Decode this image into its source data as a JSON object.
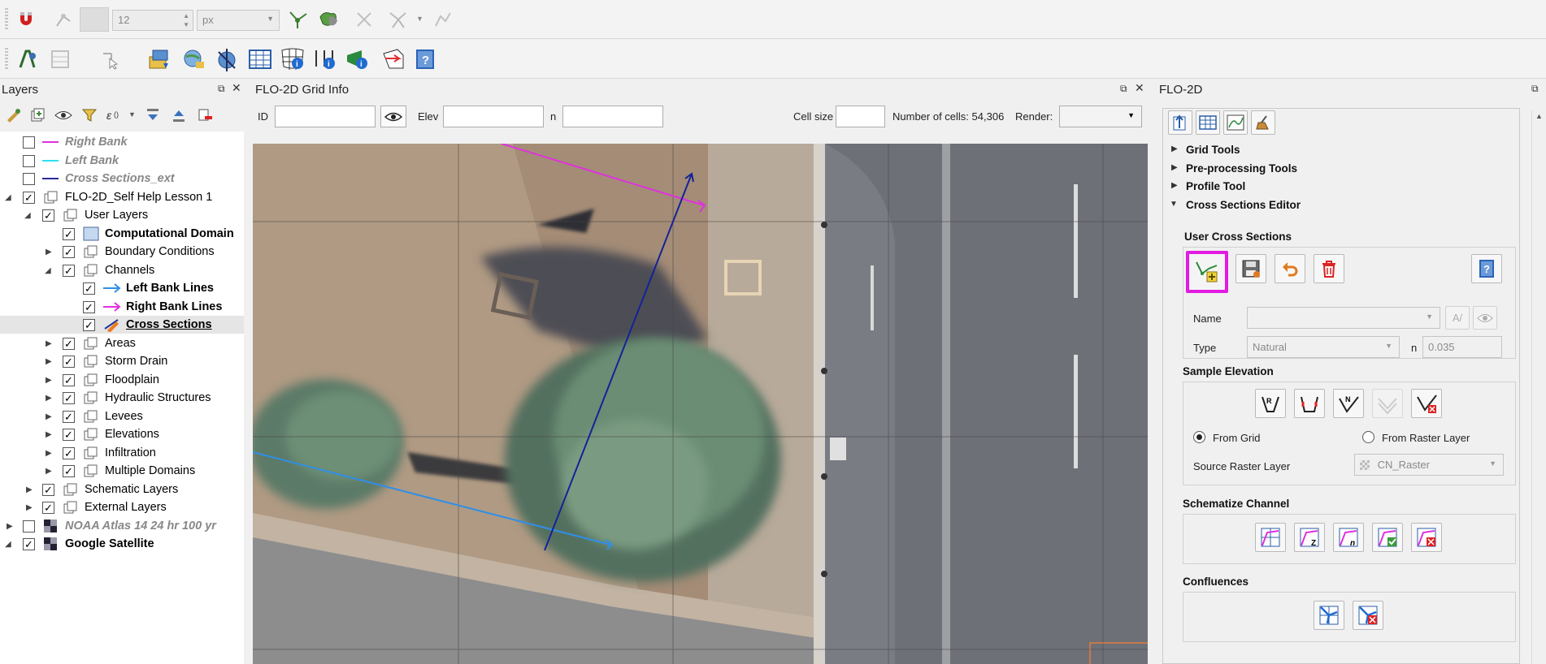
{
  "toolbar1": {
    "snap_size_value": "12",
    "snap_unit": "px"
  },
  "layers_panel": {
    "title": "Layers",
    "items": [
      {
        "label": "Right Bank",
        "checked": false,
        "style": "italic-gray",
        "legend": "magenta-line"
      },
      {
        "label": "Left Bank",
        "checked": false,
        "style": "italic-gray",
        "legend": "cyan-line"
      },
      {
        "label": "Cross Sections_ext",
        "checked": false,
        "style": "italic-gray",
        "legend": "navy-line"
      },
      {
        "label": "FLO-2D_Self Help Lesson 1",
        "checked": true,
        "style": "normal",
        "legend": "group-icon"
      },
      {
        "label": "User Layers",
        "checked": true,
        "style": "normal",
        "legend": "group-icon"
      },
      {
        "label": "Computational Domain",
        "checked": true,
        "style": "bold",
        "legend": "polygon-fill"
      },
      {
        "label": "Boundary Conditions",
        "checked": true,
        "style": "normal",
        "legend": "group-icon"
      },
      {
        "label": "Channels",
        "checked": true,
        "style": "normal",
        "legend": "group-icon"
      },
      {
        "label": "Left Bank Lines",
        "checked": true,
        "style": "bold",
        "legend": "blue-arrow"
      },
      {
        "label": "Right Bank Lines",
        "checked": true,
        "style": "bold",
        "legend": "magenta-arrow"
      },
      {
        "label": "Cross Sections",
        "checked": true,
        "style": "bold-underline",
        "legend": "edit-pencil"
      },
      {
        "label": "Areas",
        "checked": true,
        "style": "normal",
        "legend": "group-icon"
      },
      {
        "label": "Storm Drain",
        "checked": true,
        "style": "normal",
        "legend": "group-icon"
      },
      {
        "label": "Floodplain",
        "checked": true,
        "style": "normal",
        "legend": "group-icon"
      },
      {
        "label": "Hydraulic Structures",
        "checked": true,
        "style": "normal",
        "legend": "group-icon"
      },
      {
        "label": "Levees",
        "checked": true,
        "style": "normal",
        "legend": "group-icon"
      },
      {
        "label": "Elevations",
        "checked": true,
        "style": "normal",
        "legend": "group-icon"
      },
      {
        "label": "Infiltration",
        "checked": true,
        "style": "normal",
        "legend": "group-icon"
      },
      {
        "label": "Multiple Domains",
        "checked": true,
        "style": "normal",
        "legend": "group-icon"
      },
      {
        "label": "Schematic Layers",
        "checked": true,
        "style": "normal",
        "legend": "group-icon"
      },
      {
        "label": "External Layers",
        "checked": true,
        "style": "normal",
        "legend": "group-icon"
      },
      {
        "label": "NOAA Atlas 14 24 hr 100 yr",
        "checked": false,
        "style": "italic-gray-bold",
        "legend": "raster-icon"
      },
      {
        "label": "Google Satellite",
        "checked": true,
        "style": "bold",
        "legend": "raster-icon"
      }
    ]
  },
  "grid_info": {
    "title": "FLO-2D Grid Info",
    "id_label": "ID",
    "id_value": "",
    "elev_label": "Elev",
    "elev_value": "",
    "n_label": "n",
    "n_value": "",
    "cell_size_label": "Cell size",
    "cell_size_value": "",
    "num_cells_text": "Number of cells: 54,306",
    "render_label": "Render:",
    "render_value": ""
  },
  "flo2d_panel": {
    "title": "FLO-2D",
    "sections": [
      {
        "label": "Grid Tools",
        "expanded": false
      },
      {
        "label": "Pre-processing Tools",
        "expanded": false
      },
      {
        "label": "Profile Tool",
        "expanded": false
      },
      {
        "label": "Cross Sections Editor",
        "expanded": true
      }
    ],
    "user_cross_sections": {
      "title": "User Cross Sections",
      "name_label": "Name",
      "name_value": "",
      "type_label": "Type",
      "type_value": "Natural",
      "n_label": "n",
      "n_value": "0.035"
    },
    "sample_elevation": {
      "title": "Sample Elevation",
      "from_grid_label": "From Grid",
      "from_grid_selected": true,
      "from_raster_label": "From Raster Layer",
      "source_raster_label": "Source Raster Layer",
      "source_raster_value": "CN_Raster"
    },
    "schematize_channel": {
      "title": "Schematize Channel"
    },
    "confluences": {
      "title": "Confluences"
    }
  },
  "colors": {
    "highlight": "#e21be2",
    "accent_blue": "#1e6fc8",
    "map_line_magenta": "#e030e0",
    "map_line_blue": "#2f8fe8",
    "map_line_navy": "#13239a"
  }
}
